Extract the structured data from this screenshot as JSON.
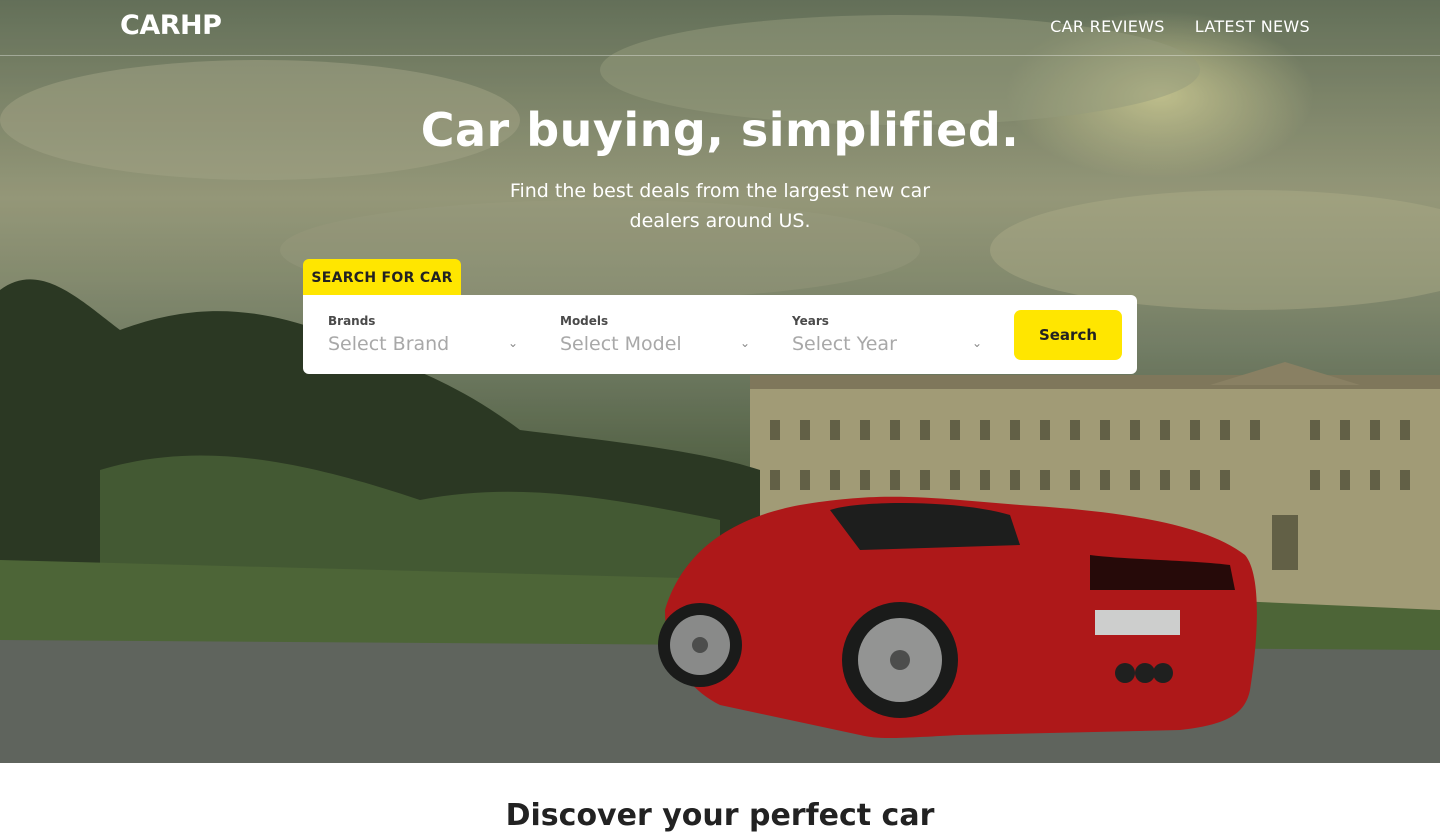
{
  "brand": {
    "logo_text": "CARHP"
  },
  "nav": {
    "items": [
      {
        "label": "CAR REVIEWS"
      },
      {
        "label": "LATEST NEWS"
      }
    ]
  },
  "hero": {
    "headline_regular": "Car buying, ",
    "headline_bold": "simplified",
    "headline_end": ".",
    "subheadline": "Find the best deals from the largest new car dealers around US."
  },
  "search": {
    "tab_label": "SEARCH FOR CAR",
    "fields": [
      {
        "label": "Brands",
        "value": "Select Brand"
      },
      {
        "label": "Models",
        "value": "Select Model"
      },
      {
        "label": "Years",
        "value": "Select Year"
      }
    ],
    "button_label": "Search"
  },
  "section": {
    "title": "Discover your perfect car"
  },
  "colors": {
    "accent": "#ffe600",
    "hero_text": "#ffffff",
    "car": "#d01d1d"
  },
  "icons": [
    "chevron-down-icon",
    "car-image"
  ]
}
